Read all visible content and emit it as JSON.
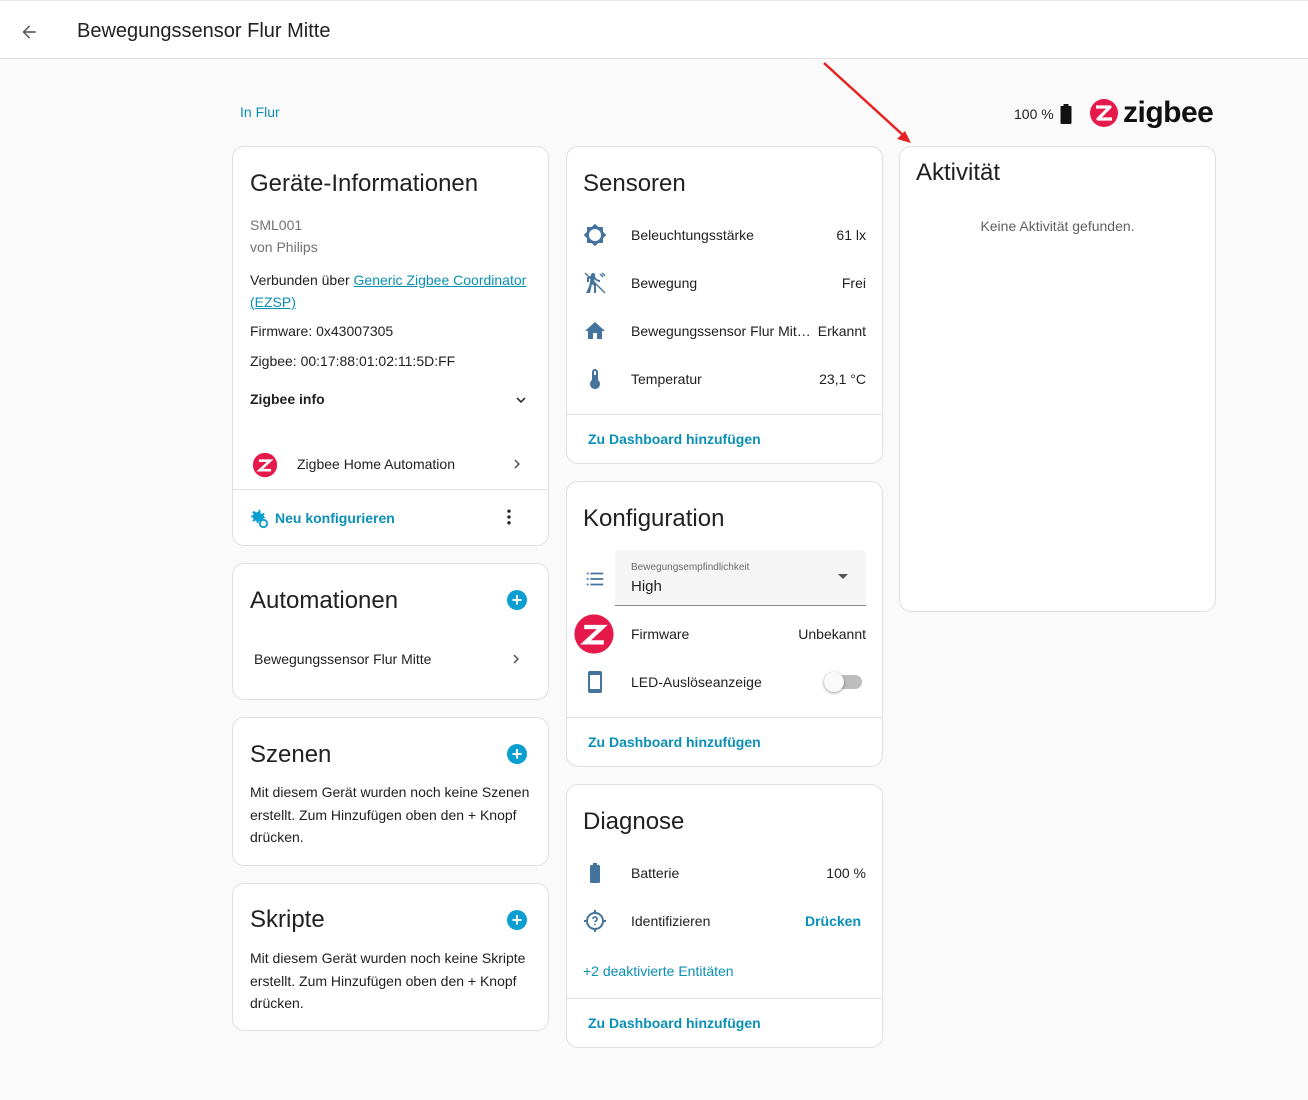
{
  "header": {
    "title": "Bewegungssensor Flur Mitte"
  },
  "area_link": "In Flur",
  "battery": {
    "value": "100 %"
  },
  "brand": {
    "name": "zigbee",
    "accent": "#e6194b"
  },
  "accent_color": "#0a8fb5",
  "device_info": {
    "title": "Geräte-Informationen",
    "model": "SML001",
    "manufacturer": "von Philips",
    "connected_prefix": "Verbunden über ",
    "connected_link": "Generic Zigbee Coordinator (EZSP)",
    "firmware": "Firmware: 0x43007305",
    "zigbee": "Zigbee: 00:17:88:01:02:11:5D:FF",
    "zigbee_info_label": "Zigbee info",
    "integration": "Zigbee Home Automation",
    "reconfigure": "Neu konfigurieren"
  },
  "automations": {
    "title": "Automationen",
    "items": [
      "Bewegungssensor Flur Mitte"
    ]
  },
  "scenes": {
    "title": "Szenen",
    "text": "Mit diesem Gerät wurden noch keine Szenen erstellt. Zum Hinzufügen oben den + Knopf drücken."
  },
  "scripts": {
    "title": "Skripte",
    "text": "Mit diesem Gerät wurden noch keine Skripte erstellt. Zum Hinzufügen oben den + Knopf drücken."
  },
  "sensors": {
    "title": "Sensoren",
    "rows": [
      {
        "icon": "brightness-icon",
        "name": "Beleuchtungsstärke",
        "value": "61 lx"
      },
      {
        "icon": "motion-icon",
        "name": "Bewegung",
        "value": "Frei"
      },
      {
        "icon": "home-icon",
        "name": "Bewegungssensor Flur Mitte Belegung",
        "value": "Erkannt"
      },
      {
        "icon": "thermometer-icon",
        "name": "Temperatur",
        "value": "23,1 °C"
      }
    ],
    "add_dashboard": "Zu Dashboard hinzufügen"
  },
  "configuration": {
    "title": "Konfiguration",
    "select_label": "Bewegungsempfindlichkeit",
    "select_value": "High",
    "firmware_name": "Firmware",
    "firmware_value": "Unbekannt",
    "led_name": "LED-Auslöseanzeige",
    "led_on": false,
    "add_dashboard": "Zu Dashboard hinzufügen"
  },
  "diagnostics": {
    "title": "Diagnose",
    "battery_name": "Batterie",
    "battery_value": "100 %",
    "identify_name": "Identifizieren",
    "identify_action": "Drücken",
    "disabled_entities": "+2 deaktivierte Entitäten",
    "add_dashboard": "Zu Dashboard hinzufügen"
  },
  "activity": {
    "title": "Aktivität",
    "empty": "Keine Aktivität gefunden."
  }
}
